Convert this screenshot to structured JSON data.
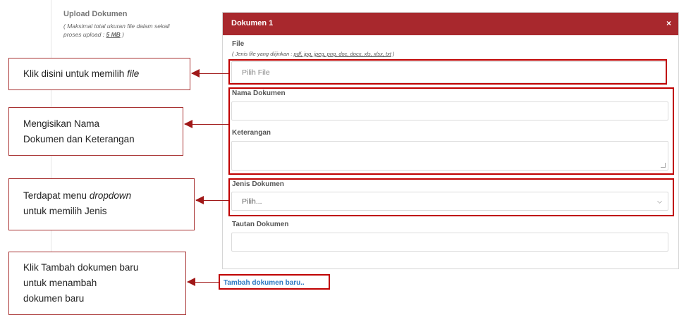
{
  "upload": {
    "label": "Upload Dokumen",
    "note_line1": "( Maksimal total ukuran file dalam sekali",
    "note_prefix": "proses upload : ",
    "note_size": "5 MB",
    "note_suffix": " )"
  },
  "modal": {
    "title": "Dokumen 1",
    "close": "×",
    "file_label": "File",
    "file_hint_prefix": "( Jenis file yang diijinkan : ",
    "file_hint_types": "pdf, jpg, jpeg, png, doc, docx, xls, xlsx, txt",
    "file_hint_suffix": " )",
    "file_placeholder": "Pilih File",
    "nama_label": "Nama Dokumen",
    "keterangan_label": "Keterangan",
    "jenis_label": "Jenis Dokumen",
    "jenis_selected": "Pilih...",
    "tautan_label": "Tautan Dokumen"
  },
  "add_link": "Tambah dokumen baru..",
  "callouts": {
    "file": {
      "text": "Klik disini untuk memilih ",
      "emph": "file"
    },
    "nama": {
      "line1": "Mengisikan Nama",
      "line2": "Dokumen dan Keterangan"
    },
    "jenis": {
      "line1_prefix": "Terdapat menu ",
      "line1_emph": "dropdown",
      "line2": "untuk memilih Jenis"
    },
    "tambah": {
      "line1": "Klik Tambah dokumen baru",
      "line2": "untuk menambah",
      "line3": "dokumen baru"
    }
  },
  "colors": {
    "header": "#a8282d",
    "highlight": "#c00000",
    "link": "#2b78c2"
  },
  "icons": {
    "close": "close-icon",
    "chevron": "chevron-down-icon",
    "arrow": "arrow-left-icon"
  }
}
